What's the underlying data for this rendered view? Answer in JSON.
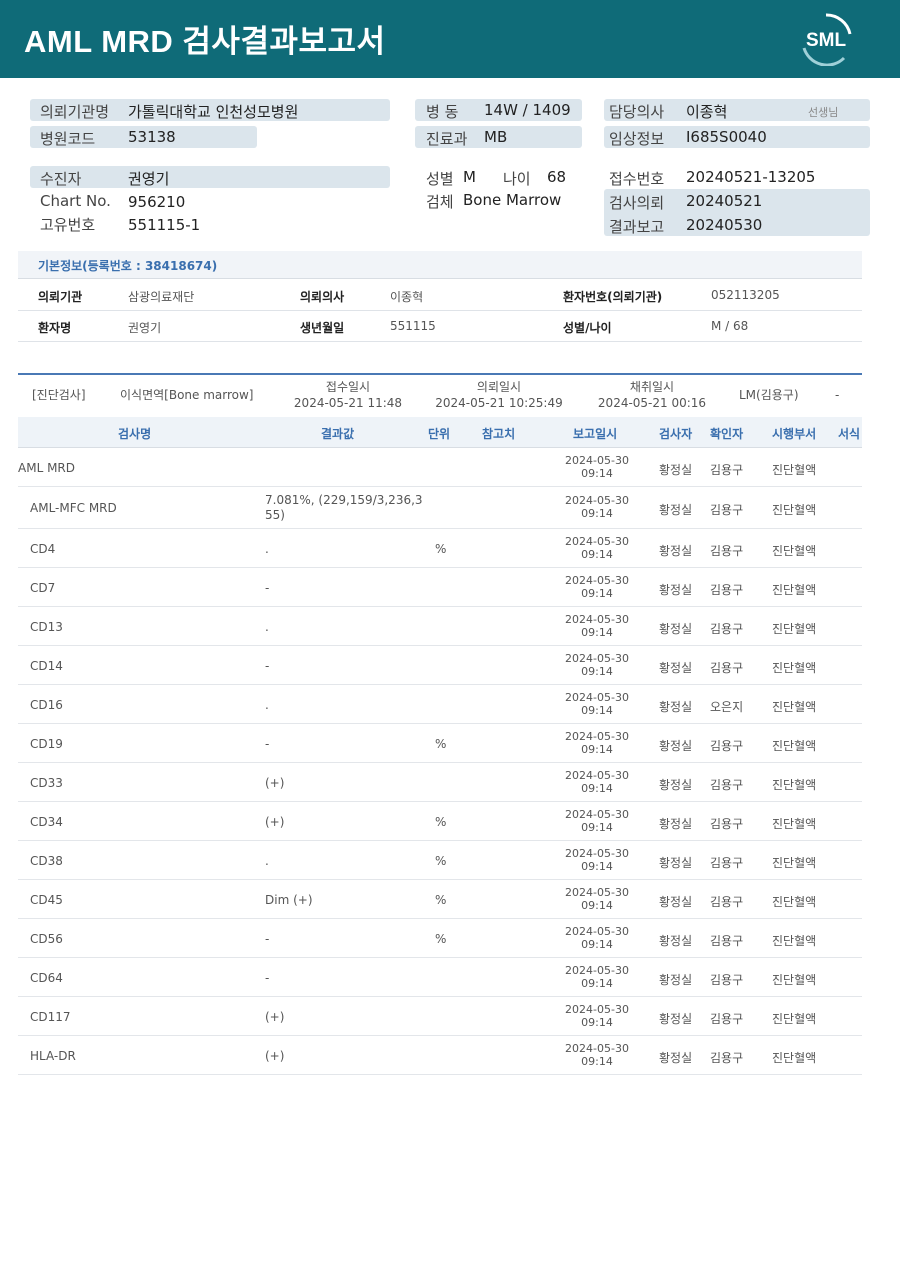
{
  "header": {
    "title": "AML  MRD 검사결과보고서",
    "logo_text": "SML"
  },
  "top_info": {
    "hospital_label": "의뢰기관명",
    "hospital_value": "가톨릭대학교 인천성모병원",
    "code_label": "병원코드",
    "code_value": "53138",
    "ward_label": "병  동",
    "ward_value": "14W / 1409",
    "dept_label": "진료과",
    "dept_value": "MB",
    "doctor_label": "담당의사",
    "doctor_value": "이종혁",
    "doctor_suffix": "선생님",
    "clinical_label": "임상정보",
    "clinical_value": "I685S0040",
    "patient_label": "수진자",
    "patient_value": "권영기",
    "chart_label": "Chart No.",
    "chart_value": "956210",
    "id_label": "고유번호",
    "id_value": "551115-1",
    "sex_label": "성별",
    "sex_value": "M",
    "age_label": "나이",
    "age_value": "68",
    "specimen_label": "검체",
    "specimen_value": "Bone Marrow",
    "receipt_label": "접수번호",
    "receipt_value": "20240521-13205",
    "request_label": "검사의뢰",
    "request_value": "20240521",
    "report_label": "결과보고",
    "report_value": "20240530"
  },
  "basic_info": {
    "heading": "기본정보(등록번호 : 38418674)",
    "rows": [
      {
        "k1": "의뢰기관",
        "v1": "삼광의료재단",
        "k2": "의뢰의사",
        "v2": "이종혁",
        "k3": "환자번호(의뢰기관)",
        "v3": "052113205"
      },
      {
        "k1": "환자명",
        "v1": "권영기",
        "k2": "생년월일",
        "v2": "551115",
        "k3": "성별/나이",
        "v3": "M / 68"
      }
    ]
  },
  "diagnosis": {
    "type": "[진단검사]",
    "specimen": "이식면역[Bone marrow]",
    "receipt_label": "접수일시",
    "receipt_time": "2024-05-21 11:48",
    "request_label": "의뢰일시",
    "request_time": "2024-05-21 10:25:49",
    "collect_label": "채취일시",
    "collect_time": "2024-05-21 00:16",
    "lm": "LM(김용구)",
    "dash": "-"
  },
  "table": {
    "headers": [
      "검사명",
      "결과값",
      "단위",
      "참고치",
      "보고일시",
      "검사자",
      "확인자",
      "시행부서",
      "서식"
    ],
    "rows": [
      {
        "name": "AML MRD",
        "result": "",
        "unit": "",
        "date": "2024-05-30",
        "time": "09:14",
        "tester": "황정실",
        "checker": "김용구",
        "dept": "진단혈액"
      },
      {
        "name": "AML-MFC MRD",
        "result": "7.081%, (229,159/3,236,3",
        "result2": "55)",
        "unit": "",
        "date": "2024-05-30",
        "time": "09:14",
        "tester": "황정실",
        "checker": "김용구",
        "dept": "진단혈액"
      },
      {
        "name": "CD4",
        "result": ".",
        "unit": "%",
        "date": "2024-05-30",
        "time": "09:14",
        "tester": "황정실",
        "checker": "김용구",
        "dept": "진단혈액"
      },
      {
        "name": "CD7",
        "result": "-",
        "unit": "",
        "date": "2024-05-30",
        "time": "09:14",
        "tester": "황정실",
        "checker": "김용구",
        "dept": "진단혈액"
      },
      {
        "name": "CD13",
        "result": ".",
        "unit": "",
        "date": "2024-05-30",
        "time": "09:14",
        "tester": "황정실",
        "checker": "김용구",
        "dept": "진단혈액"
      },
      {
        "name": "CD14",
        "result": "-",
        "unit": "",
        "date": "2024-05-30",
        "time": "09:14",
        "tester": "황정실",
        "checker": "김용구",
        "dept": "진단혈액"
      },
      {
        "name": "CD16",
        "result": ".",
        "unit": "",
        "date": "2024-05-30",
        "time": "09:14",
        "tester": "황정실",
        "checker": "오은지",
        "dept": "진단혈액"
      },
      {
        "name": "CD19",
        "result": "-",
        "unit": "%",
        "date": "2024-05-30",
        "time": "09:14",
        "tester": "황정실",
        "checker": "김용구",
        "dept": "진단혈액"
      },
      {
        "name": "CD33",
        "result": "(+)",
        "unit": "",
        "date": "2024-05-30",
        "time": "09:14",
        "tester": "황정실",
        "checker": "김용구",
        "dept": "진단혈액"
      },
      {
        "name": "CD34",
        "result": "(+)",
        "unit": "%",
        "date": "2024-05-30",
        "time": "09:14",
        "tester": "황정실",
        "checker": "김용구",
        "dept": "진단혈액"
      },
      {
        "name": "CD38",
        "result": ".",
        "unit": "%",
        "date": "2024-05-30",
        "time": "09:14",
        "tester": "황정실",
        "checker": "김용구",
        "dept": "진단혈액"
      },
      {
        "name": "CD45",
        "result": "Dim (+)",
        "unit": "%",
        "date": "2024-05-30",
        "time": "09:14",
        "tester": "황정실",
        "checker": "김용구",
        "dept": "진단혈액"
      },
      {
        "name": "CD56",
        "result": "-",
        "unit": "%",
        "date": "2024-05-30",
        "time": "09:14",
        "tester": "황정실",
        "checker": "김용구",
        "dept": "진단혈액"
      },
      {
        "name": "CD64",
        "result": "-",
        "unit": "",
        "date": "2024-05-30",
        "time": "09:14",
        "tester": "황정실",
        "checker": "김용구",
        "dept": "진단혈액"
      },
      {
        "name": "CD117",
        "result": "(+)",
        "unit": "",
        "date": "2024-05-30",
        "time": "09:14",
        "tester": "황정실",
        "checker": "김용구",
        "dept": "진단혈액"
      },
      {
        "name": "HLA-DR",
        "result": "(+)",
        "unit": "",
        "date": "2024-05-30",
        "time": "09:14",
        "tester": "황정실",
        "checker": "김용구",
        "dept": "진단혈액"
      }
    ]
  },
  "colors": {
    "header_bg": "#0f6b78",
    "label_bg": "#dbe5ec",
    "accent_blue": "#3a6fae"
  }
}
